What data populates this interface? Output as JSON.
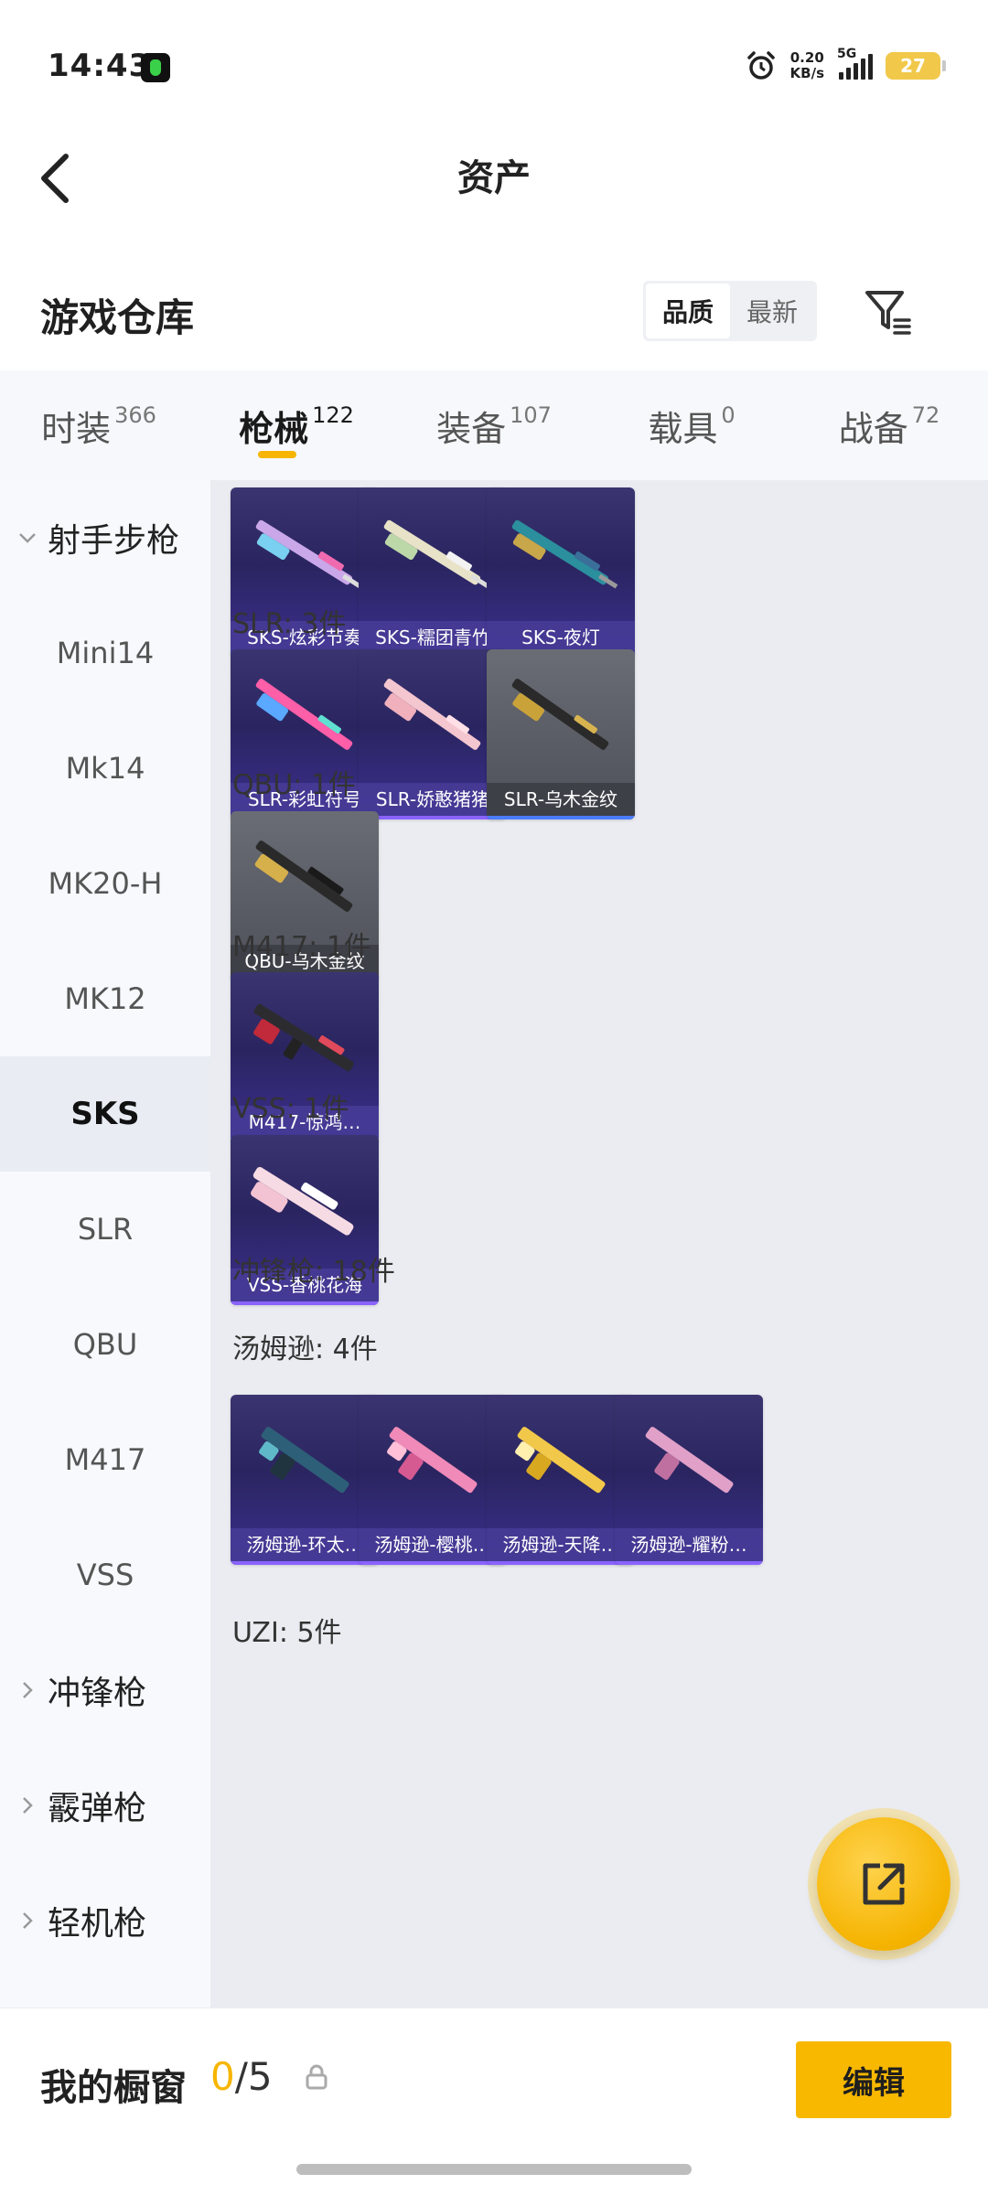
{
  "status_bar": {
    "time": "14:43",
    "net_speed_value": "0.20",
    "net_speed_unit": "KB/s",
    "network": "5G",
    "battery": "27"
  },
  "header": {
    "title": "资产",
    "back_icon": "chevron-left-icon"
  },
  "warehouse": {
    "title": "游戏仓库",
    "sort_options": [
      "品质",
      "最新"
    ],
    "active_sort": "品质",
    "filter_icon": "filter-icon"
  },
  "category_tabs": [
    {
      "label": "时装",
      "count": "366"
    },
    {
      "label": "枪械",
      "count": "122",
      "active": true
    },
    {
      "label": "装备",
      "count": "107"
    },
    {
      "label": "载具",
      "count": "0"
    },
    {
      "label": "战备",
      "count": "72"
    }
  ],
  "sidebar": {
    "items": [
      {
        "label": "射手步枪",
        "type": "group",
        "expanded": true
      },
      {
        "label": "Mini14"
      },
      {
        "label": "Mk14"
      },
      {
        "label": "MK20-H"
      },
      {
        "label": "MK12"
      },
      {
        "label": "SKS",
        "active": true
      },
      {
        "label": "SLR"
      },
      {
        "label": "QBU"
      },
      {
        "label": "M417"
      },
      {
        "label": "VSS"
      },
      {
        "label": "冲锋枪",
        "type": "group",
        "expanded": false
      },
      {
        "label": "霰弹枪",
        "type": "group",
        "expanded": false
      },
      {
        "label": "轻机枪",
        "type": "group",
        "expanded": false
      }
    ]
  },
  "content": {
    "sks_items": [
      "SKS-炫彩节奏",
      "SKS-糯团青竹",
      "SKS-夜灯"
    ],
    "slr_label": "SLR: 3件",
    "slr_items": [
      "SLR-彩虹符号",
      "SLR-娇憨猪猪",
      "SLR-乌木金纹"
    ],
    "qbu_label": "QBU: 1件",
    "qbu_items": [
      "QBU-乌木金纹"
    ],
    "m417_label": "M417: 1件",
    "m417_items": [
      "M417-惊鸿…"
    ],
    "vss_label": "VSS: 1件",
    "vss_items": [
      "VSS-香桃花海"
    ],
    "smg_label": "冲锋枪: 18件",
    "tommy_label": "汤姆逊: 4件",
    "tommy_items": [
      "汤姆逊-环太…",
      "汤姆逊-樱桃…",
      "汤姆逊-天降…",
      "汤姆逊-耀粉…"
    ],
    "uzi_label": "UZI: 5件"
  },
  "share_button": {
    "icon": "share-external-icon"
  },
  "bottom_bar": {
    "showcase_label": "我的橱窗",
    "showcase_current": "0",
    "showcase_total": "/5",
    "lock_icon": "lock-icon",
    "edit_label": "编辑"
  },
  "colors": {
    "accent": "#f8b800",
    "tile_purple": "#2a2560",
    "tile_gray": "#585b63"
  }
}
